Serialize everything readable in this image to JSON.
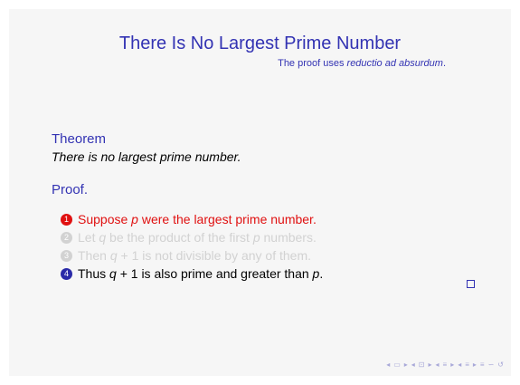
{
  "slide": {
    "title": "There Is No Largest Prime Number",
    "subtitle_prefix": "The proof uses ",
    "subtitle_emph": "reductio ad absurdum",
    "subtitle_suffix": "."
  },
  "theorem": {
    "label": "Theorem",
    "statement": "There is no largest prime number."
  },
  "proof": {
    "label": "Proof.",
    "steps": [
      {
        "num": "1",
        "parts": [
          "Suppose ",
          "p",
          " were the largest prime number."
        ]
      },
      {
        "num": "2",
        "parts": [
          "Let ",
          "q",
          " be the product of the first ",
          "p",
          " numbers."
        ]
      },
      {
        "num": "3",
        "parts": [
          "Then ",
          "q",
          " + 1 is not divisible by any of them."
        ]
      },
      {
        "num": "4",
        "parts": [
          "Thus ",
          "q",
          " + 1 is also prime and greater than ",
          "p",
          "."
        ]
      }
    ]
  },
  "nav": {
    "icons": [
      "◂",
      "▭",
      "▸",
      "◂",
      "⊡",
      "▸",
      "◂",
      "≡",
      "▸",
      "◂",
      "≡",
      "▸",
      "≡",
      "∽",
      "↺"
    ]
  },
  "colors": {
    "accent": "#3333b3",
    "alert": "#e01010",
    "faded": "#d2d2d2"
  }
}
